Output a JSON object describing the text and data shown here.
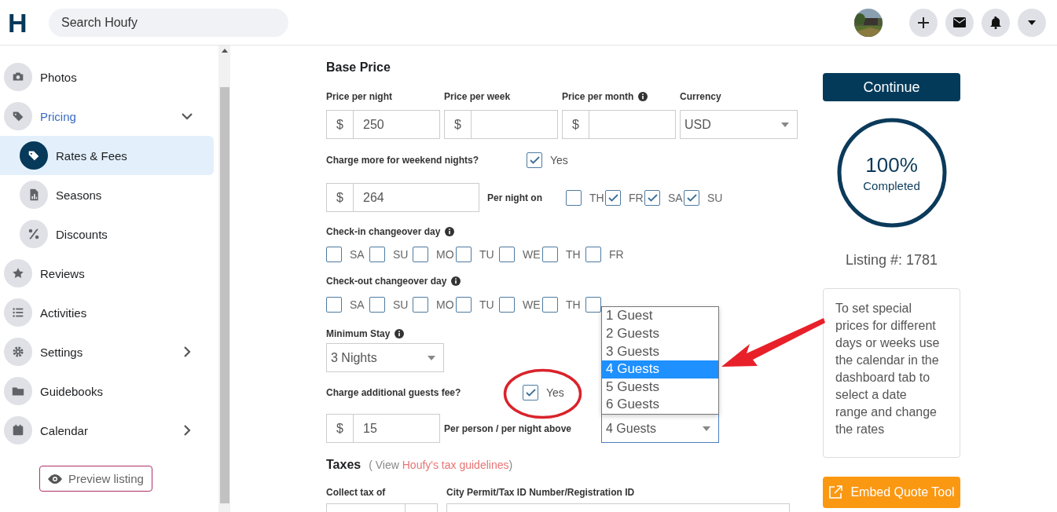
{
  "header": {
    "logo": "H",
    "search": {
      "placeholder": "Search Houfy"
    }
  },
  "sidebar": {
    "items": [
      {
        "label": "Photos",
        "selected": false
      },
      {
        "label": "Pricing",
        "selected": false,
        "expanded": true,
        "children": [
          {
            "label": "Rates & Fees",
            "selected": true
          },
          {
            "label": "Seasons",
            "selected": false
          },
          {
            "label": "Discounts",
            "selected": false
          }
        ]
      },
      {
        "label": "Reviews",
        "selected": false
      },
      {
        "label": "Activities",
        "selected": false
      },
      {
        "label": "Settings",
        "selected": false,
        "expanded": false
      },
      {
        "label": "Guidebooks",
        "selected": false
      },
      {
        "label": "Calendar",
        "selected": false,
        "expanded": false
      }
    ],
    "preview_button": "Preview listing"
  },
  "form": {
    "base_price": {
      "title": "Base Price",
      "fields": [
        {
          "label": "Price per night",
          "kind": "money",
          "prefix": "$",
          "value": "250"
        },
        {
          "label": "Price per week",
          "kind": "money",
          "prefix": "$"
        },
        {
          "label": "Price per month",
          "kind": "money",
          "prefix": "$",
          "info": true
        },
        {
          "label": "Currency",
          "kind": "select",
          "value": "USD"
        }
      ]
    },
    "weekend": {
      "question": "Charge more for weekend nights?",
      "checked": true,
      "option": "Yes",
      "prefix": "$",
      "value": "264",
      "days_label": "Per night on",
      "days": [
        {
          "label": "TH",
          "checked": false
        },
        {
          "label": "FR",
          "checked": true
        },
        {
          "label": "SA",
          "checked": true
        },
        {
          "label": "SU",
          "checked": true
        }
      ]
    },
    "check_in": {
      "label": "Check-in changeover day",
      "info": true,
      "days": [
        {
          "label": "SA",
          "checked": false
        },
        {
          "label": "SU",
          "checked": false
        },
        {
          "label": "MO",
          "checked": false
        },
        {
          "label": "TU",
          "checked": false
        },
        {
          "label": "WE",
          "checked": false
        },
        {
          "label": "TH",
          "checked": false
        },
        {
          "label": "FR",
          "checked": false
        }
      ]
    },
    "check_out": {
      "label": "Check-out changeover day",
      "info": true,
      "days": [
        {
          "label": "SA",
          "checked": false
        },
        {
          "label": "SU",
          "checked": false
        },
        {
          "label": "MO",
          "checked": false
        },
        {
          "label": "TU",
          "checked": false
        },
        {
          "label": "WE",
          "checked": false
        },
        {
          "label": "TH",
          "checked": false
        },
        {
          "checked": false
        }
      ]
    },
    "minimum_stay": {
      "label": "Minimum Stay",
      "info": true,
      "value": "3 Nights"
    },
    "guests_fee": {
      "question": "Charge additional guests fee?",
      "checked": true,
      "option": "Yes",
      "prefix": "$",
      "value": "15",
      "above_label": "Per person / per night above",
      "select": {
        "value": "4 Guests",
        "expanded": true,
        "options": [
          {
            "label": "1 Guest",
            "selected": false
          },
          {
            "label": "2 Guests",
            "selected": false
          },
          {
            "label": "3 Guests",
            "selected": false
          },
          {
            "label": "4 Guests",
            "selected": true
          },
          {
            "label": "5 Guests",
            "selected": false
          },
          {
            "label": "6 Guests",
            "selected": false
          }
        ]
      }
    },
    "taxes": {
      "title": "Taxes",
      "note_before": "( View ",
      "link": "Houfy's tax guidelines",
      "note_after": ")",
      "fields": [
        {
          "label": "Collect tax of"
        },
        {
          "label": "City Permit/Tax ID Number/Registration ID"
        }
      ]
    }
  },
  "right": {
    "continue": "Continue",
    "progress": {
      "value": "100%",
      "label": "Completed",
      "level": 1
    },
    "listing": "Listing #: 1781",
    "tip": "To set special prices for different days or weeks use the calendar in the dashboard tab to select a date range and change the rates",
    "embed": "Embed Quote Tool"
  }
}
